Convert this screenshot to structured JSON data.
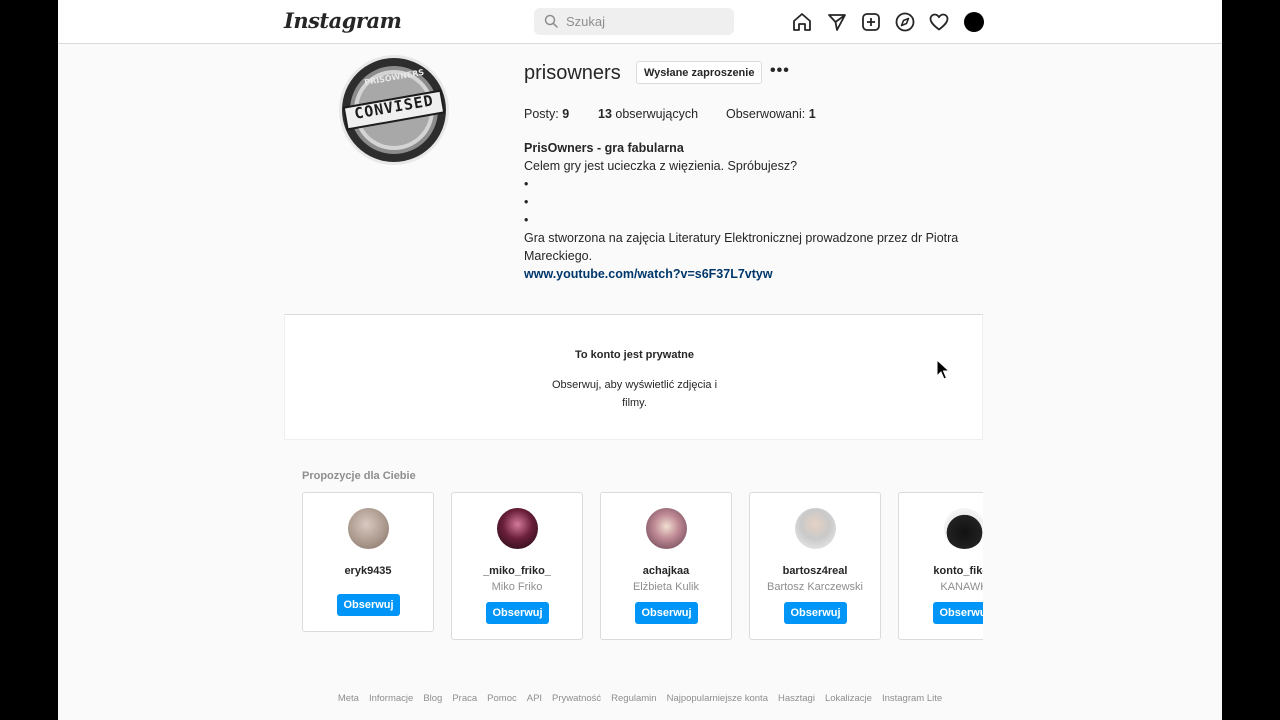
{
  "header": {
    "logo_text": "Instagram",
    "search": {
      "placeholder": "Szukaj",
      "value": ""
    },
    "icons": [
      "home-icon",
      "direct-icon",
      "new-post-icon",
      "explore-icon",
      "activity-icon",
      "profile-avatar"
    ]
  },
  "profile": {
    "username": "prisowners",
    "badge_text": "CONVISED",
    "badge_ring_text": "PRISOWNERS",
    "sent_request_label": "Wysłane zaproszenie",
    "more_label": "•••",
    "stats": {
      "posts_label": "Posty:",
      "posts_count": "9",
      "followers_count": "13",
      "followers_label": "obserwujących",
      "following_label": "Obserwowani:",
      "following_count": "1"
    },
    "bio": {
      "name": "PrisOwners - gra fabularna",
      "line1": "Celem gry jest ucieczka z więzienia. Spróbujesz?",
      "bullet1": "•",
      "bullet2": "•",
      "bullet3": "•",
      "line2": "Gra stworzona na zajęcia Literatury Elektronicznej prowadzone przez dr Piotra Mareckiego.",
      "link": "www.youtube.com/watch?v=s6F37L7vtyw"
    }
  },
  "private": {
    "title": "To konto jest prywatne",
    "subtitle": "Obserwuj, aby wyświetlić zdjęcia i filmy."
  },
  "suggestions": {
    "title": "Propozycje dla Ciebie",
    "follow_label": "Obserwuj",
    "items": [
      {
        "username": "eryk9435",
        "name": "",
        "avatar_color": "#b8a59a"
      },
      {
        "username": "_miko_friko_",
        "name": "Miko Friko",
        "avatar_color": "#5a1b2e"
      },
      {
        "username": "achajkaa",
        "name": "Elżbieta Kulik",
        "avatar_color": "#a06a78"
      },
      {
        "username": "bartosz4real",
        "name": "Bartosz Karczewski",
        "avatar_color": "#d9d9d9"
      },
      {
        "username": "konto_fikcy",
        "name": "KANAWK",
        "avatar_color": "#222222"
      }
    ]
  },
  "footer": {
    "links": [
      "Meta",
      "Informacje",
      "Blog",
      "Praca",
      "Pomoc",
      "API",
      "Prywatność",
      "Regulamin",
      "Najpopularniejsze konta",
      "Hasztagi",
      "Lokalizacje",
      "Instagram Lite"
    ]
  }
}
